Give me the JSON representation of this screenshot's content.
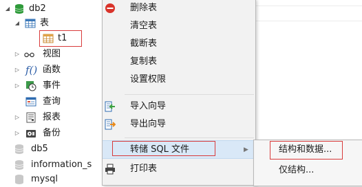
{
  "tree": {
    "db2": "db2",
    "tables": "表",
    "t1": "t1",
    "views": "视图",
    "functions": "函数",
    "events": "事件",
    "queries": "查询",
    "reports": "报表",
    "backups": "备份",
    "db5": "db5",
    "information_schema": "information_s",
    "mysql": "mysql"
  },
  "menu": {
    "delete_table": "删除表",
    "empty_table": "清空表",
    "truncate_table": "截断表",
    "duplicate_table": "复制表",
    "set_permissions": "设置权限",
    "import_wizard": "导入向导",
    "export_wizard": "导出向导",
    "dump_sql": "转储 SQL 文件",
    "print_table": "打印表"
  },
  "submenu": {
    "structure_and_data": "结构和数据...",
    "structure_only": "仅结构..."
  },
  "colors": {
    "db_green": "#2f9a3a",
    "highlight": "#d9e8f7",
    "annotation_red": "#d83a3a"
  }
}
